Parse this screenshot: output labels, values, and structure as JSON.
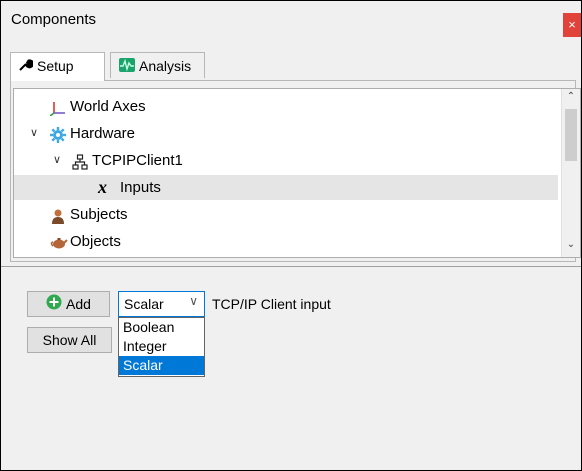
{
  "window": {
    "title": "Components",
    "close_glyph": "×"
  },
  "tabs": [
    {
      "label": "Setup",
      "icon": "wrench-icon",
      "active": true
    },
    {
      "label": "Analysis",
      "icon": "waveform-icon",
      "active": false
    }
  ],
  "tree": {
    "items": [
      {
        "label": "World Axes",
        "icon": "axes-icon",
        "expanded": null
      },
      {
        "label": "Hardware",
        "icon": "gear-icon",
        "expanded": true
      },
      {
        "label": "TCPIPClient1",
        "icon": "network-icon",
        "expanded": true
      },
      {
        "label": "Inputs",
        "icon": "variable-x-icon",
        "expanded": null,
        "selected": true
      },
      {
        "label": "Subjects",
        "icon": "person-icon",
        "expanded": null
      },
      {
        "label": "Objects",
        "icon": "teapot-icon",
        "expanded": null
      }
    ]
  },
  "controls": {
    "add_label": "Add",
    "show_all_label": "Show All",
    "type_selected": "Scalar",
    "input_label": "TCP/IP Client input",
    "type_options": [
      "Boolean",
      "Integer",
      "Scalar"
    ]
  },
  "colors": {
    "accent": "#0078d7",
    "close_bg": "#e1423a",
    "selected_row": "#e5e5e5"
  }
}
